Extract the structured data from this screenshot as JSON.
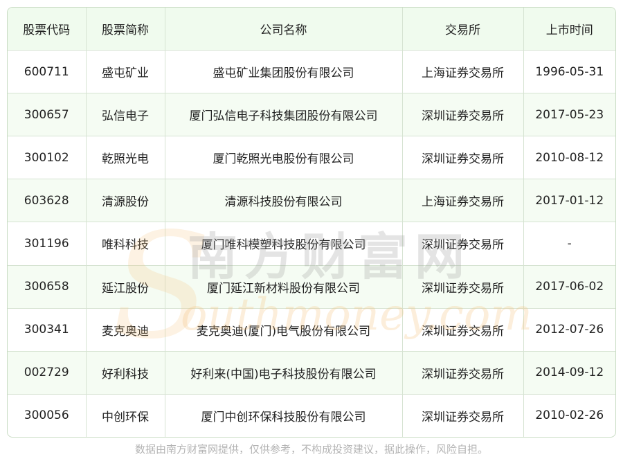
{
  "table": {
    "headers": [
      "股票代码",
      "股票简称",
      "公司名称",
      "交易所",
      "上市时间"
    ],
    "rows": [
      [
        "600711",
        "盛屯矿业",
        "盛屯矿业集团股份有限公司",
        "上海证券交易所",
        "1996-05-31"
      ],
      [
        "300657",
        "弘信电子",
        "厦门弘信电子科技集团股份有限公司",
        "深圳证券交易所",
        "2017-05-23"
      ],
      [
        "300102",
        "乾照光电",
        "厦门乾照光电股份有限公司",
        "深圳证券交易所",
        "2010-08-12"
      ],
      [
        "603628",
        "清源股份",
        "清源科技股份有限公司",
        "上海证券交易所",
        "2017-01-12"
      ],
      [
        "301196",
        "唯科科技",
        "厦门唯科模塑科技股份有限公司",
        "深圳证券交易所",
        "-"
      ],
      [
        "300658",
        "延江股份",
        "厦门延江新材料股份有限公司",
        "深圳证券交易所",
        "2017-06-02"
      ],
      [
        "300341",
        "麦克奥迪",
        "麦克奥迪(厦门)电气股份有限公司",
        "深圳证券交易所",
        "2012-07-26"
      ],
      [
        "002729",
        "好利科技",
        "好利来(中国)电子科技股份有限公司",
        "深圳证券交易所",
        "2014-09-12"
      ],
      [
        "300056",
        "中创环保",
        "厦门中创环保科技股份有限公司",
        "深圳证券交易所",
        "2010-02-26"
      ]
    ]
  },
  "watermark": {
    "cn": "南方财富网",
    "en": "outhmoney.com",
    "initial": "S",
    "color_cn": "#9e9e9e",
    "color_en": "#f6c27e"
  },
  "footnote": "数据由南方财富网提供，仅供参考，不构成投资建议，据此操作，风险自担。"
}
